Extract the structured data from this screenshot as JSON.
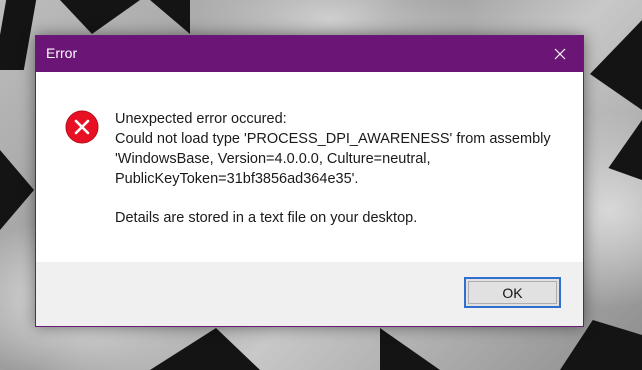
{
  "window": {
    "title": "Error",
    "close_icon": "close-icon",
    "accent_color": "#6b1577"
  },
  "message": {
    "icon": "error-icon",
    "icon_color": "#e81123",
    "lines": [
      "Unexpected error occured:",
      "Could not load type 'PROCESS_DPI_AWARENESS' from assembly",
      "'WindowsBase, Version=4.0.0.0, Culture=neutral,",
      "PublicKeyToken=31bf3856ad364e35'."
    ],
    "details": "Details are stored in a text file on your desktop."
  },
  "buttons": {
    "ok_label": "OK"
  }
}
